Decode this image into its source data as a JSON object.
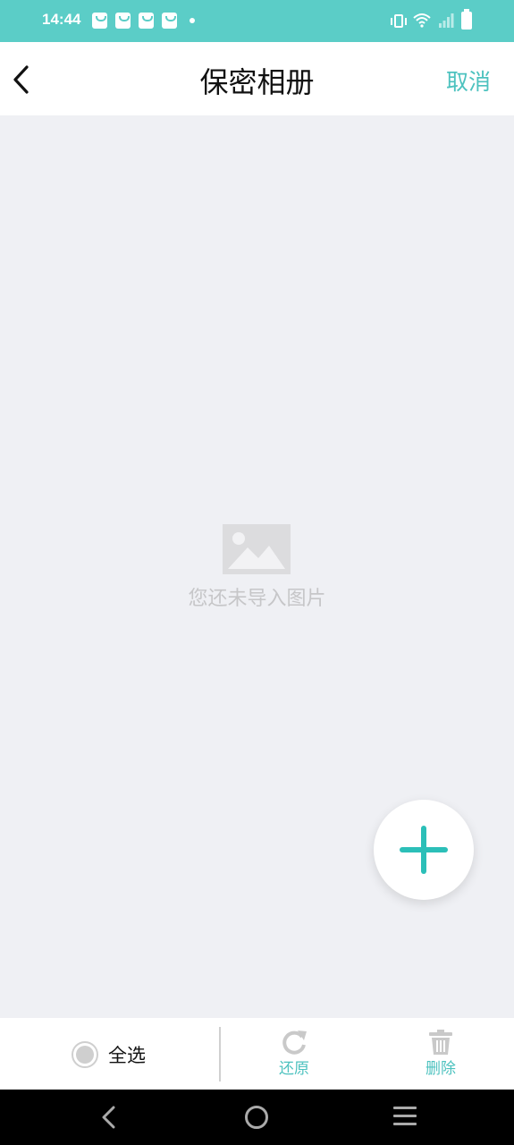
{
  "status_bar": {
    "time": "14:44",
    "notification_icons": [
      "shopping-bag-icon",
      "shopping-bag-icon",
      "shopping-bag-icon",
      "shopping-bag-icon",
      "dot-icon"
    ],
    "system_icons": [
      "vibrate-icon",
      "wifi-icon",
      "signal-icon",
      "battery-icon"
    ],
    "background_color": "#5bcdc7"
  },
  "header": {
    "title": "保密相册",
    "cancel_label": "取消",
    "back_icon": "chevron-left-icon"
  },
  "content": {
    "empty_icon": "image-placeholder-icon",
    "empty_text": "您还未导入图片"
  },
  "fab": {
    "icon": "plus-icon",
    "accent_color": "#2bbfb8"
  },
  "bottom_bar": {
    "select_all_label": "全选",
    "restore_label": "还原",
    "restore_icon": "refresh-icon",
    "delete_label": "删除",
    "delete_icon": "trash-icon",
    "action_color": "#4dc2bf"
  },
  "system_nav": {
    "items": [
      "back-icon",
      "home-icon",
      "menu-icon"
    ]
  }
}
